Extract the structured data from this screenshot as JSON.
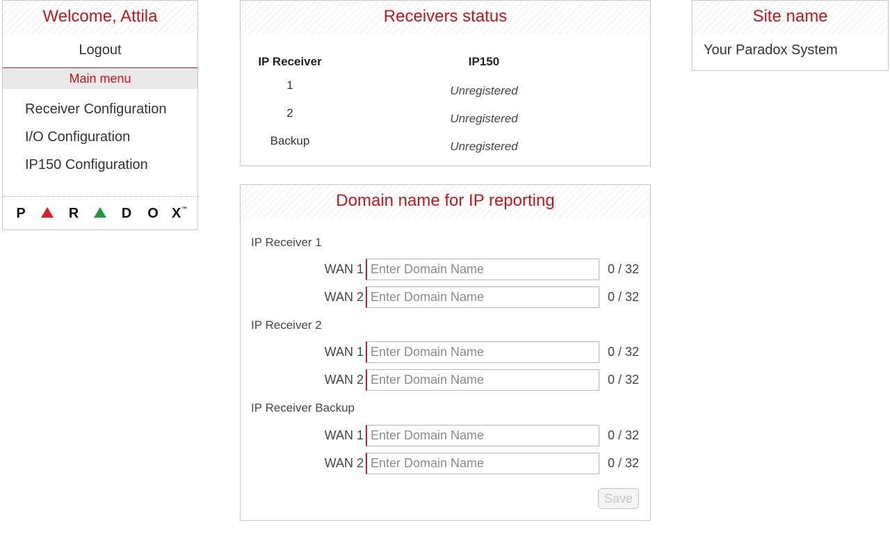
{
  "menu": {
    "welcome": "Welcome, Attila",
    "logout": "Logout",
    "main_menu": "Main menu",
    "items": [
      {
        "label": "Receiver Configuration"
      },
      {
        "label": "I/O Configuration"
      },
      {
        "label": "IP150 Configuration"
      }
    ],
    "logo": {
      "letters": [
        "P",
        "R",
        "D",
        "O",
        "X"
      ],
      "trademark": "™",
      "triangle_colors": [
        "#e01b22",
        "#1e9a3e"
      ]
    }
  },
  "status": {
    "title": "Receivers status",
    "headers": [
      "IP Receiver",
      "IP150"
    ],
    "rows": [
      {
        "receiver": "1",
        "ip150": "Unregistered"
      },
      {
        "receiver": "2",
        "ip150": "Unregistered"
      },
      {
        "receiver": "Backup",
        "ip150": "Unregistered"
      }
    ]
  },
  "site": {
    "title": "Site name",
    "value": "Your Paradox System"
  },
  "domain": {
    "title": "Domain name for IP reporting",
    "sections": [
      {
        "label": "IP Receiver 1",
        "wans": [
          {
            "label": "WAN 1",
            "value": "",
            "placeholder": "Enter Domain Name",
            "count": "0 / 32"
          },
          {
            "label": "WAN 2",
            "value": "",
            "placeholder": "Enter Domain Name",
            "count": "0 / 32"
          }
        ]
      },
      {
        "label": "IP Receiver 2",
        "wans": [
          {
            "label": "WAN 1",
            "value": "",
            "placeholder": "Enter Domain Name",
            "count": "0 / 32"
          },
          {
            "label": "WAN 2",
            "value": "",
            "placeholder": "Enter Domain Name",
            "count": "0 / 32"
          }
        ]
      },
      {
        "label": "IP Receiver Backup",
        "wans": [
          {
            "label": "WAN 1",
            "value": "",
            "placeholder": "Enter Domain Name",
            "count": "0 / 32"
          },
          {
            "label": "WAN 2",
            "value": "",
            "placeholder": "Enter Domain Name",
            "count": "0 / 32"
          }
        ]
      }
    ],
    "save_label": "Save"
  },
  "colors": {
    "accent": "#c0161f",
    "menu_header_bg": "#e8e8e8"
  }
}
